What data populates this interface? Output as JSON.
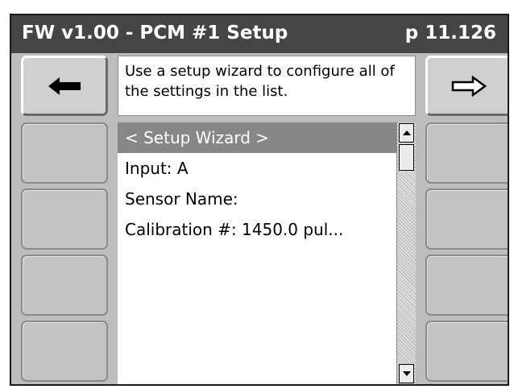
{
  "header": {
    "title": "FW v1.00 - PCM #1 Setup",
    "page_number": "p 11.126"
  },
  "nav": {
    "back_icon": "left-arrow-icon",
    "forward_icon": "right-arrow-icon"
  },
  "help": {
    "text": "Use a setup wizard to configure all of the settings in the list."
  },
  "list": {
    "items": [
      {
        "label": "< Setup Wizard >",
        "selected": true
      },
      {
        "label": "Input: A",
        "selected": false
      },
      {
        "label": "Sensor Name:",
        "selected": false
      },
      {
        "label": "Calibration #: 1450.0 pul...",
        "selected": false
      }
    ]
  },
  "scrollbar": {
    "up_icon": "scroll-up-arrow-icon",
    "down_icon": "scroll-down-arrow-icon"
  },
  "colors": {
    "titlebar": "#454545",
    "screen_bg": "#bdbdbd",
    "selected_row": "#878787"
  }
}
